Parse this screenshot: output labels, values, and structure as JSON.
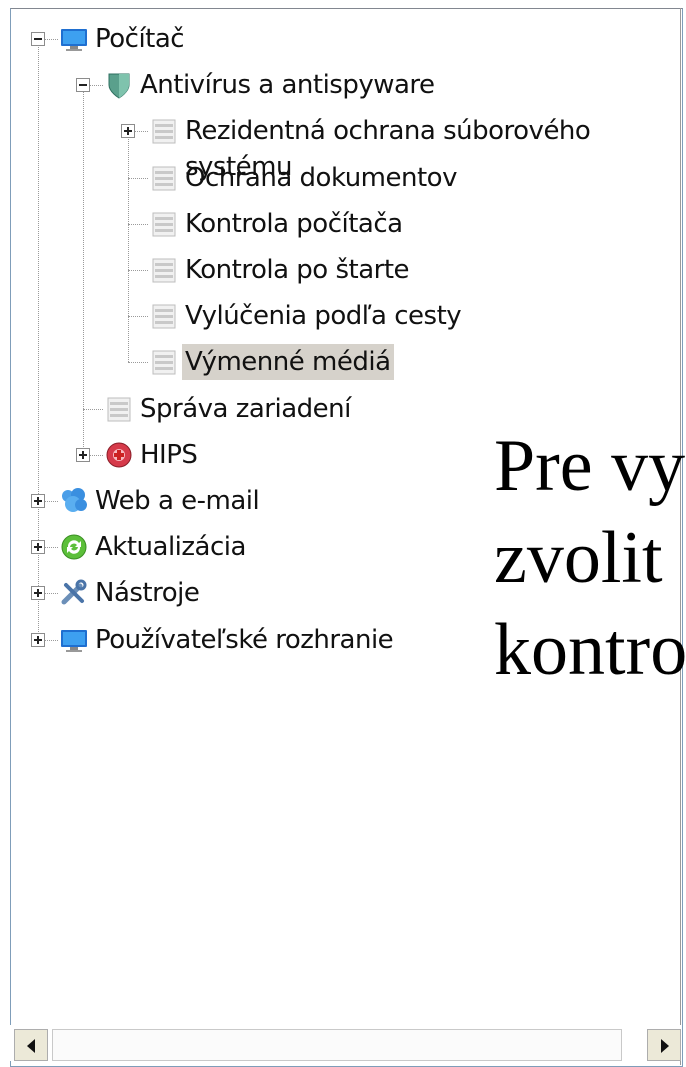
{
  "tree": {
    "items": [
      {
        "label": "Počítač",
        "icon": "monitor-icon",
        "level": 0,
        "expander": "minus"
      },
      {
        "label": "Antivírus a antispyware",
        "icon": "shield-icon",
        "level": 1,
        "expander": "minus"
      },
      {
        "label": "Rezidentná ochrana súborového systému",
        "icon": "page-icon",
        "level": 2,
        "expander": "plus"
      },
      {
        "label": "Ochrana dokumentov",
        "icon": "page-icon",
        "level": 2,
        "expander": "none"
      },
      {
        "label": "Kontrola počítača",
        "icon": "page-icon",
        "level": 2,
        "expander": "none"
      },
      {
        "label": "Kontrola po štarte",
        "icon": "page-icon",
        "level": 2,
        "expander": "none"
      },
      {
        "label": "Vylúčenia podľa cesty",
        "icon": "page-icon",
        "level": 2,
        "expander": "none"
      },
      {
        "label": "Výmenné médiá",
        "icon": "page-icon",
        "level": 2,
        "expander": "none",
        "selected": true
      },
      {
        "label": "Správa zariadení",
        "icon": "page-icon",
        "level": 1,
        "expander": "none"
      },
      {
        "label": "HIPS",
        "icon": "hips-icon",
        "level": 1,
        "expander": "plus"
      },
      {
        "label": "Web a e-mail",
        "icon": "globe-icon",
        "level": 0,
        "expander": "plus"
      },
      {
        "label": "Aktualizácia",
        "icon": "update-icon",
        "level": 0,
        "expander": "plus"
      },
      {
        "label": "Nástroje",
        "icon": "tools-icon",
        "level": 0,
        "expander": "plus"
      },
      {
        "label": "Používateľské rozhranie",
        "icon": "monitor-icon",
        "level": 0,
        "expander": "plus"
      }
    ]
  },
  "overlay": {
    "lines": [
      "Pre vy",
      "zvolit",
      "kontro"
    ]
  },
  "colors": {
    "selection": "#d6d2cb",
    "shield": "#5aa08c",
    "monitor": "#2a7fd4"
  }
}
